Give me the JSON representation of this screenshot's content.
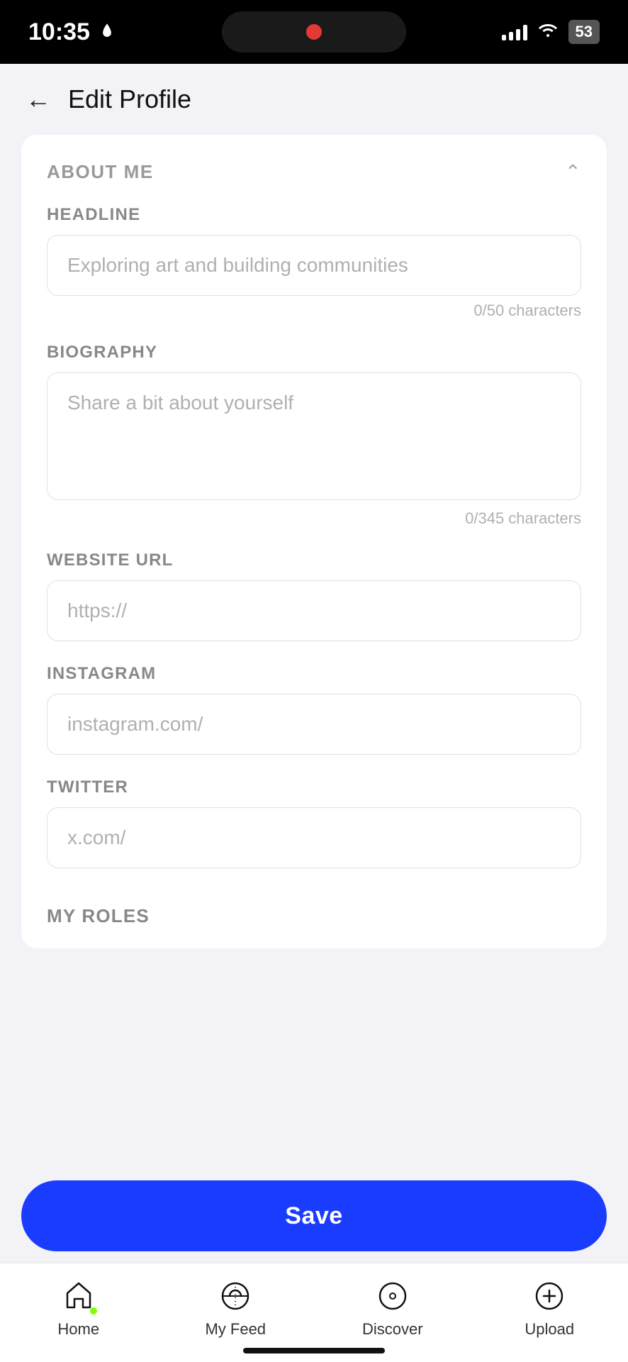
{
  "statusBar": {
    "time": "10:35",
    "batteryLabel": "53"
  },
  "header": {
    "title": "Edit Profile",
    "backLabel": "←"
  },
  "form": {
    "sectionTitle": "ABOUT ME",
    "headline": {
      "label": "HEADLINE",
      "placeholder": "Exploring art and building communities",
      "charCount": "0/50 characters"
    },
    "biography": {
      "label": "BIOGRAPHY",
      "placeholder": "Share a bit about yourself",
      "charCount": "0/345 characters"
    },
    "websiteUrl": {
      "label": "WEBSITE URL",
      "value": "https://"
    },
    "instagram": {
      "label": "INSTAGRAM",
      "value": "instagram.com/"
    },
    "twitter": {
      "label": "TWITTER",
      "value": "x.com/"
    },
    "myRoles": {
      "label": "MY ROLES"
    }
  },
  "saveButton": {
    "label": "Save"
  },
  "bottomNav": {
    "items": [
      {
        "id": "home",
        "label": "Home",
        "active": true
      },
      {
        "id": "myfeed",
        "label": "My Feed",
        "active": false
      },
      {
        "id": "discover",
        "label": "Discover",
        "active": false
      },
      {
        "id": "upload",
        "label": "Upload",
        "active": false
      }
    ]
  }
}
